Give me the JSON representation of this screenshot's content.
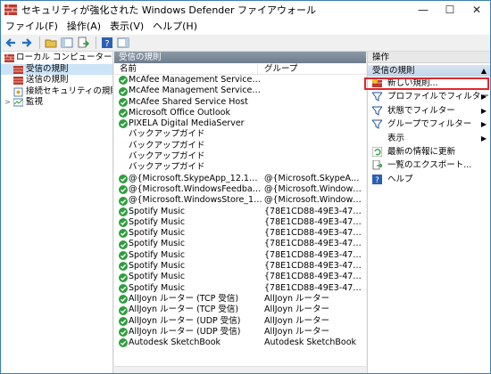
{
  "window": {
    "title": "セキュリティが強化された Windows Defender ファイアウォール",
    "min_glyph": "—",
    "max_glyph": "☐",
    "close_glyph": "✕"
  },
  "menu": [
    "ファイル(F)",
    "操作(A)",
    "表示(V)",
    "ヘルプ(H)"
  ],
  "tree": {
    "root": "ローカル コンピューター のセキュリティ",
    "items": [
      "受信の規則",
      "送信の規則",
      "接続セキュリティの規則",
      "監視"
    ],
    "selected": "受信の規則"
  },
  "center": {
    "header": "受信の規則",
    "col_name": "名前",
    "col_group": "グループ",
    "rows": [
      {
        "name": "McAfee Management Service Host (x64)",
        "group": "",
        "enabled": true
      },
      {
        "name": "McAfee Management Service Host (x86)",
        "group": "",
        "enabled": true
      },
      {
        "name": "McAfee Shared Service Host",
        "group": "",
        "enabled": true
      },
      {
        "name": "Microsoft Office Outlook",
        "group": "",
        "enabled": true
      },
      {
        "name": "PIXELA Digital MediaServer",
        "group": "",
        "enabled": true
      },
      {
        "name": "バックアップガイド",
        "group": "",
        "enabled": false
      },
      {
        "name": "バックアップガイド",
        "group": "",
        "enabled": false
      },
      {
        "name": "バックアップガイド",
        "group": "",
        "enabled": false
      },
      {
        "name": "バックアップガイド",
        "group": "",
        "enabled": false
      },
      {
        "name": "@{Microsoft.SkypeApp_12.1807.264.0_x6...",
        "group": "@{Microsoft.SkypeApp_12.1807.26...",
        "enabled": true
      },
      {
        "name": "@{Microsoft.WindowsFeedbackHub_1.17...",
        "group": "@{Microsoft.WindowsFeed...",
        "enabled": true
      },
      {
        "name": "@{Microsoft.WindowsStore_11802.1001.8...",
        "group": "@{Microsoft.WindowsStore...",
        "enabled": true
      },
      {
        "name": "Spotify Music",
        "group": "{78E1CD88-49E3-476E-B926-...",
        "enabled": true
      },
      {
        "name": "Spotify Music",
        "group": "{78E1CD88-49E3-476E-B926-...",
        "enabled": true
      },
      {
        "name": "Spotify Music",
        "group": "{78E1CD88-49E3-476E-B926-...",
        "enabled": true
      },
      {
        "name": "Spotify Music",
        "group": "{78E1CD88-49E3-476E-B926-...",
        "enabled": true
      },
      {
        "name": "Spotify Music",
        "group": "{78E1CD88-49E3-476E-B926-...",
        "enabled": true
      },
      {
        "name": "Spotify Music",
        "group": "{78E1CD88-49E3-476E-B926-...",
        "enabled": true
      },
      {
        "name": "Spotify Music",
        "group": "{78E1CD88-49E3-476E-B926-...",
        "enabled": true
      },
      {
        "name": "Spotify Music",
        "group": "{78E1CD88-49E3-476E-B926-...",
        "enabled": true
      },
      {
        "name": "AllJoyn ルーター (TCP 受信)",
        "group": "AllJoyn ルーター",
        "enabled": true
      },
      {
        "name": "AllJoyn ルーター (TCP 受信)",
        "group": "AllJoyn ルーター",
        "enabled": true
      },
      {
        "name": "AllJoyn ルーター (UDP 受信)",
        "group": "AllJoyn ルーター",
        "enabled": true
      },
      {
        "name": "AllJoyn ルーター (UDP 受信)",
        "group": "AllJoyn ルーター",
        "enabled": true
      },
      {
        "name": "Autodesk SketchBook",
        "group": "Autodesk SketchBook",
        "enabled": true
      }
    ]
  },
  "actions": {
    "header": "操作",
    "section": "受信の規則",
    "section_arrow": "▲",
    "items": [
      {
        "label": "新しい規則...",
        "icon": "new-rule-icon",
        "arrow": ""
      },
      {
        "label": "プロファイルでフィルター",
        "icon": "filter-icon",
        "arrow": "▶"
      },
      {
        "label": "状態でフィルター",
        "icon": "filter-icon",
        "arrow": "▶"
      },
      {
        "label": "グループでフィルター",
        "icon": "filter-icon",
        "arrow": "▶"
      },
      {
        "label": "表示",
        "icon": "",
        "arrow": "▶"
      },
      {
        "label": "最新の情報に更新",
        "icon": "refresh-icon",
        "arrow": ""
      },
      {
        "label": "一覧のエクスポート...",
        "icon": "export-icon",
        "arrow": ""
      },
      {
        "label": "ヘルプ",
        "icon": "help-icon",
        "arrow": ""
      }
    ]
  },
  "colors": {
    "enabled": "#2e9e3e",
    "highlight": "#e0262b",
    "panel_header": "#7a8896"
  }
}
